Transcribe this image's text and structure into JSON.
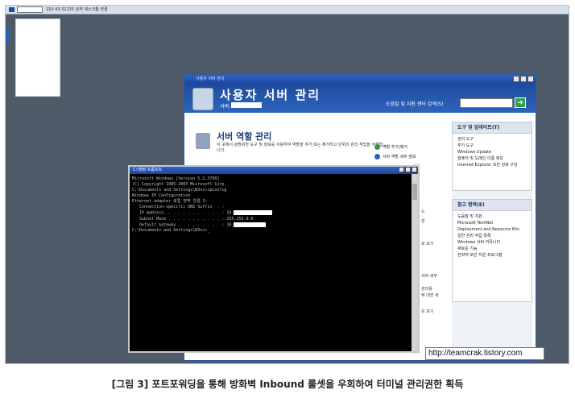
{
  "rdp": {
    "title_text": "210           43.31135  원격 데스크톱 연결"
  },
  "server_window": {
    "title": "사용자 서버 관리",
    "heading": "사용자 서버 관리",
    "server_label": "서버:",
    "help_text": "도움말 및 지원 센터 검색(S)",
    "go_icon": "arrow-right-icon",
    "role_title": "서버 역할 관리",
    "role_desc": "이 곳에서 광범위한 도구 및 정보를 사용하여 역할을 추가 또는 제거하고 단위의 관리 작업을 수행합니다.",
    "role_links": [
      "역할 추가/제거",
      "서버 역할 세부 정보"
    ],
    "mid_fragments": [
      "드",
      "관",
      "보 보기",
      "서버 세부",
      "관리용",
      "에 대한 세",
      "보 보기"
    ]
  },
  "task_pane": {
    "tools_head": "도구 및 업데이트(T)",
    "tools_items": [
      "관리 도구",
      "추가 도구",
      "Windows Update",
      "컴퓨터 및 도메인 이름 정보",
      "Internet Explorer 보안 강화 구성"
    ],
    "refs_head": "참고 항목(E)",
    "refs_items": [
      "도움말 및 지원",
      "Microsoft TechNet",
      "Deployment and Resource Kits",
      "일반 관리 작업 목록",
      "Windows 서버 커뮤니티",
      "새로운 기능",
      "전략적 보안 지원 프로그램"
    ]
  },
  "cmd": {
    "title": "C:\\명령 프롬프트",
    "lines": [
      "Microsoft Windows [Version 5.2.3790]",
      "(C) Copyright 1985-2003 Microsoft Corp.",
      "",
      "C:\\Documents and Settings\\W3sc>ipconfig",
      "",
      "Windows IP Configuration",
      "",
      "",
      "Ethernet adapter 로컬 영역 연결 5:",
      "",
      "   Connection-specific DNS Suffix  . :",
      "   IP Address. . . . . . . . . . . . : 10.",
      "   Subnet Mask . . . . . . . . . . . : 255.255.0.0",
      "   Default Gateway . . . . . . . . . : 10.",
      "",
      "C:\\Documents and Settings\\W3sc>_"
    ]
  },
  "watermark": "http://teamcrak.tistory.com",
  "caption": "[그림 3] 포트포워딩을 통해 방화벽 Inbound 룰셋을 우회하여 터미널 관리권한 획득"
}
